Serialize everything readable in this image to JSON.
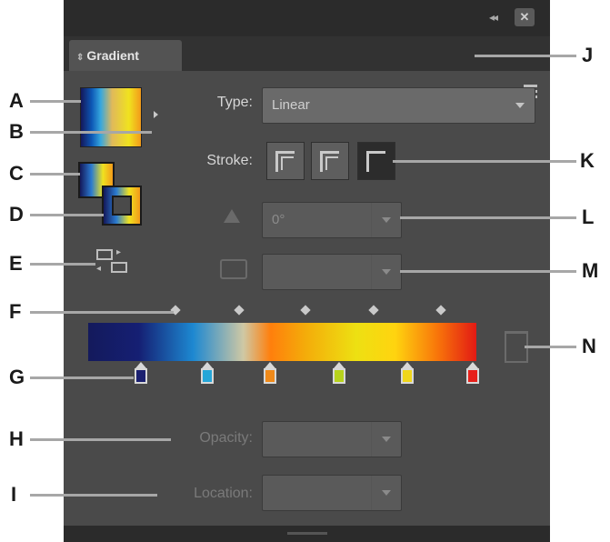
{
  "window": {
    "collapse_icon": "double-chevron-right-icon",
    "close_icon": "close-icon"
  },
  "tab": {
    "label": "Gradient",
    "arrows_icon": "expand-arrows-icon"
  },
  "panel_menu_icon": "panel-menu-icon",
  "type_row": {
    "label": "Type:",
    "value": "Linear"
  },
  "stroke_row": {
    "label": "Stroke:",
    "buttons": [
      "apply-within-stroke",
      "apply-along-stroke",
      "apply-across-stroke"
    ],
    "selected": 2
  },
  "angle_row": {
    "value": "0°",
    "icon": "angle-icon"
  },
  "aspect_row": {
    "value": "",
    "icon": "aspect-ratio-icon"
  },
  "opacity_row": {
    "label": "Opacity:",
    "value": ""
  },
  "location_row": {
    "label": "Location:",
    "value": ""
  },
  "gradient_ramp": {
    "stop_colors": [
      "#1b2070",
      "#25a6d8",
      "#f08a1a",
      "#b7d21c",
      "#f0d61a",
      "#e8201a"
    ],
    "midpoint_count": 5
  },
  "callouts": [
    "A",
    "B",
    "C",
    "D",
    "E",
    "F",
    "G",
    "H",
    "I",
    "J",
    "K",
    "L",
    "M",
    "N"
  ]
}
